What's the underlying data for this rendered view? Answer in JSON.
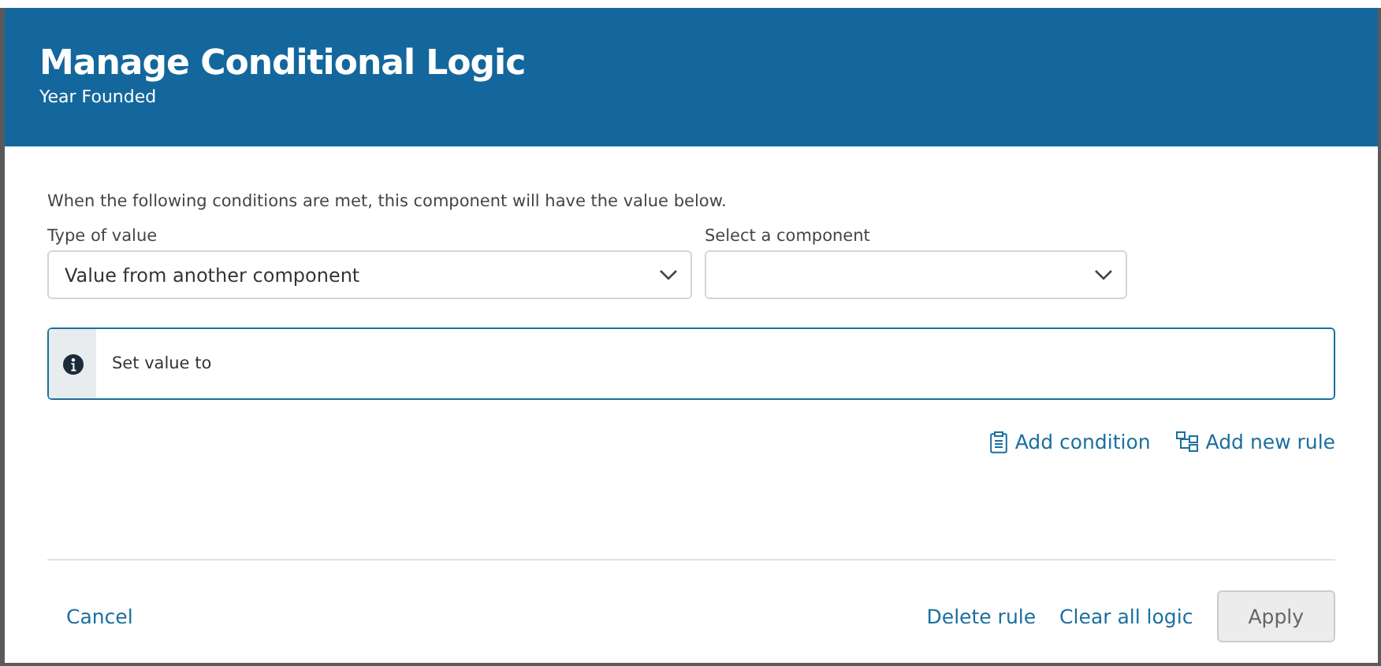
{
  "dialog": {
    "title": "Manage Conditional Logic",
    "subtitle": "Year Founded"
  },
  "instruction": "When the following conditions are met, this component will have the value below.",
  "selects": [
    {
      "label": "Type of value",
      "value": "Value from another component"
    },
    {
      "label": "Select a component"
    }
  ],
  "info": {
    "text": "Set value to"
  },
  "actions": [
    {
      "kind": "condition",
      "label": "Add condition"
    },
    {
      "kind": "rule",
      "label": "Add new rule"
    }
  ],
  "footer": {
    "cancel": "Cancel",
    "buttons": [
      {
        "label": "Delete rule",
        "kind": "link",
        "disabled": false
      },
      {
        "label": "Clear all logic",
        "kind": "link",
        "disabled": false
      },
      {
        "label": "Apply",
        "kind": "button",
        "disabled": true
      }
    ]
  }
}
